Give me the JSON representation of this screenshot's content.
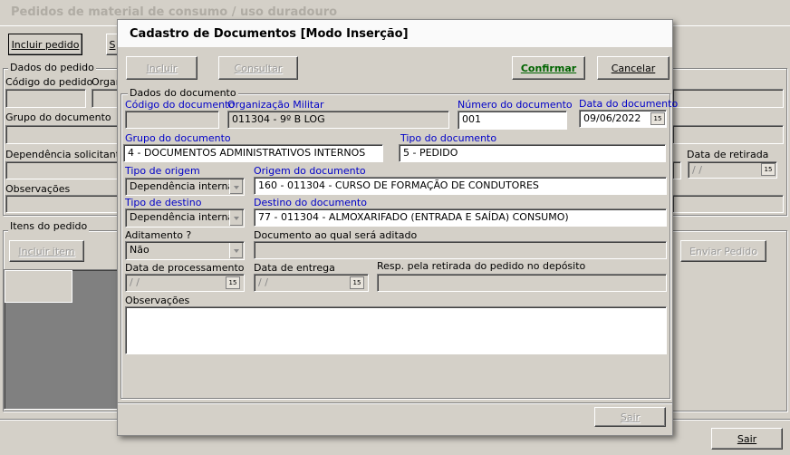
{
  "app": {
    "title": "Pedidos de material de consumo / uso duradouro"
  },
  "main": {
    "toolbar": {
      "incluir_pedido": "Incluir pedido",
      "partial_button": "S"
    },
    "dados_group": "Dados do pedido",
    "codigo_label": "Código do pedido",
    "organ_label": "Orgar",
    "grupo_label": "Grupo do documento",
    "dependencia_label": "Dependência solicitante",
    "data_retirada_label": "Data de retirada",
    "data_retirada_value": " /  /",
    "observacoes_label": "Observações",
    "itens_group": "Itens do pedido",
    "incluir_item": "Incluir item",
    "enviar_pedido": "Enviar Pedido",
    "sair": "Sair"
  },
  "modal": {
    "title": "Cadastro de Documentos [Modo Inserção]",
    "buttons": {
      "incluir": "Incluir",
      "consultar": "Consultar",
      "confirmar": "Confirmar",
      "cancelar": "Cancelar",
      "sair": "Sair"
    },
    "group_title": "Dados do documento",
    "codigo_label": "Código do documento",
    "codigo_value": "",
    "om_label": "Organização Militar",
    "om_value": "011304 - 9º B LOG",
    "numero_label": "Número do documento",
    "numero_value": "001",
    "data_label": "Data do documento",
    "data_value": "09/06/2022",
    "grupo_label": "Grupo do documento",
    "grupo_value": "4 - DOCUMENTOS ADMINISTRATIVOS INTERNOS",
    "tipo_label": "Tipo do documento",
    "tipo_value": "5 - PEDIDO",
    "tipo_origem_label": "Tipo de origem",
    "tipo_origem_value": "Dependência interna",
    "origem_label": "Origem do documento",
    "origem_value": "160 - 011304 - CURSO DE FORMAÇÃO DE CONDUTORES",
    "tipo_destino_label": "Tipo de destino",
    "tipo_destino_value": "Dependência interna",
    "destino_label": "Destino do documento",
    "destino_value": "77 - 011304 - ALMOXARIFADO (ENTRADA E SAÍDA) CONSUMO)",
    "aditamento_label": "Aditamento ?",
    "aditamento_value": "Não",
    "doc_aditado_label": "Documento ao qual será aditado",
    "data_proc_label": "Data de processamento",
    "data_proc_value": " /  /",
    "data_entrega_label": "Data de entrega",
    "data_entrega_value": " /  /",
    "resp_label": "Resp. pela retirada do pedido no depósito",
    "obs_label": "Observações",
    "calendar_glyph": "15"
  }
}
